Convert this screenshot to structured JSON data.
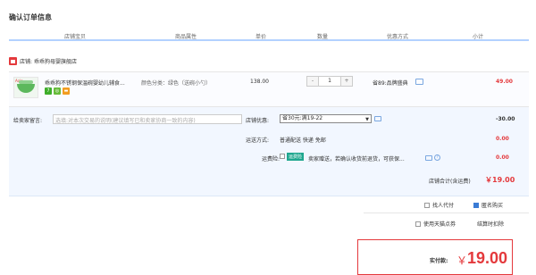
{
  "page_title": "确认订单信息",
  "columns": [
    "店铺宝贝",
    "商品属性",
    "单价",
    "数量",
    "优惠方式",
    "小计"
  ],
  "shop": {
    "label": "店铺:",
    "name": "乖乖狗母婴旗舰店"
  },
  "item": {
    "thumb_tag": "Aolo",
    "title": "乖乖狗不锈钢保温碗婴幼儿辅食...",
    "attributes": "颜色分类：绿色（送碗小勺）",
    "unit_price": "138.00",
    "quantity": "1",
    "qty_minus": "-",
    "qty_plus": "+",
    "promotion": "省89:品牌盛典",
    "subtotal": "49.00",
    "service_badges": [
      "7",
      "◎",
      "▬"
    ]
  },
  "message": {
    "label": "给卖家留言:",
    "placeholder": "选填:对本次交易的说明(建议填写已和卖家协商一致的内容)"
  },
  "shop_discount": {
    "label": "店铺优惠:",
    "selected": "省30元:满19-22",
    "arrow": "▼",
    "amount": "-30.00"
  },
  "shipping": {
    "label": "运送方式:",
    "value": "普通配送 快递 免邮",
    "amount": "0.00"
  },
  "insurance": {
    "label": "运费险:",
    "badge": "运费险",
    "text": "卖家赠送，若确认收货前退货，可获保...",
    "help": "?",
    "amount": "0.00"
  },
  "shop_total": {
    "label": "店铺合计(含运费)",
    "value": "￥19.00"
  },
  "options": {
    "proxy_pay": "找人代付",
    "anonymous": "匿名购买",
    "tmall_points": "使用天猫点券",
    "auto_deduct": "结算时扣除"
  },
  "payment": {
    "label": "实付款:",
    "currency": "￥",
    "value": "19.00"
  },
  "colors": {
    "accent_red": "#e4393c",
    "header_line": "#b2d1ff",
    "panel_bg": "#f2f7ff"
  }
}
